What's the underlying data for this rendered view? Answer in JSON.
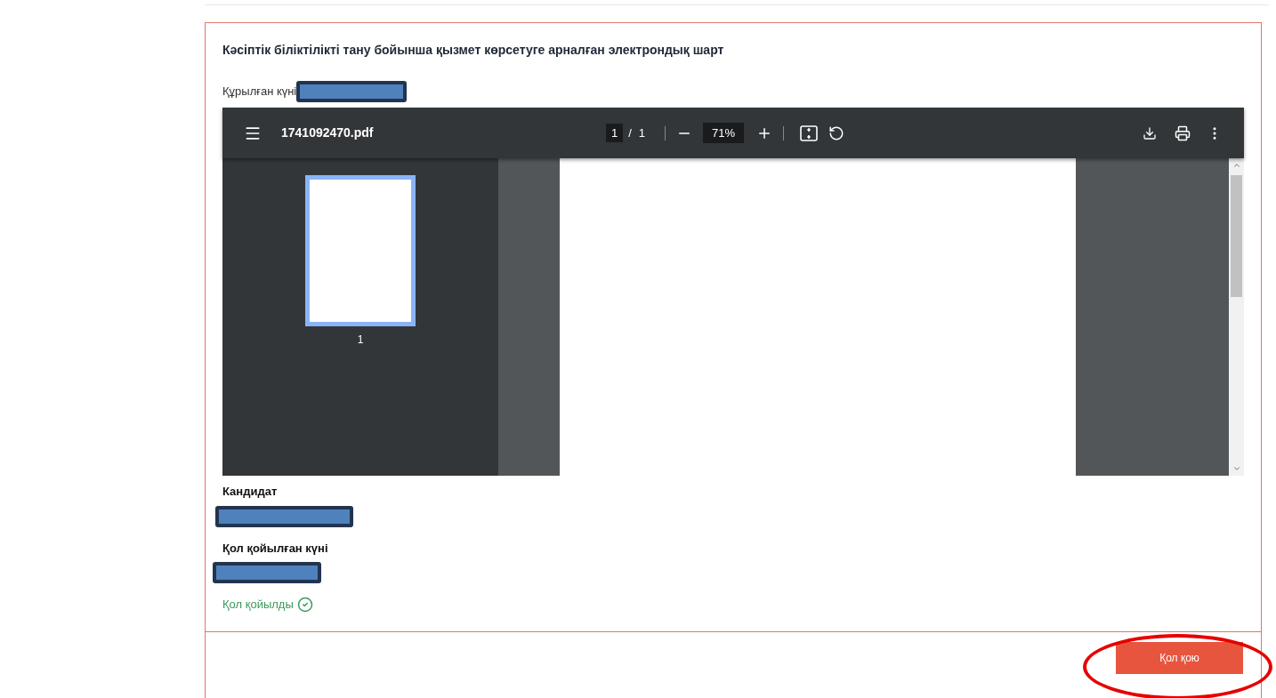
{
  "document": {
    "title": "Кәсіптік біліктілікті тану бойынша қызмет көрсетуге арналған электрондық шарт",
    "created_label": "Құрылған күні"
  },
  "viewer": {
    "filename": "1741092470.pdf",
    "page_current": "1",
    "page_separator": "/",
    "page_total": "1",
    "zoom": "71%",
    "thumbnails": [
      {
        "label": "1",
        "selected": true
      }
    ]
  },
  "candidate_label": "Кандидат",
  "signed_date_label": "Қол қойылған күні",
  "status": {
    "text": "Қол қойылды",
    "signed": true
  },
  "sign_button": "Қол қою"
}
